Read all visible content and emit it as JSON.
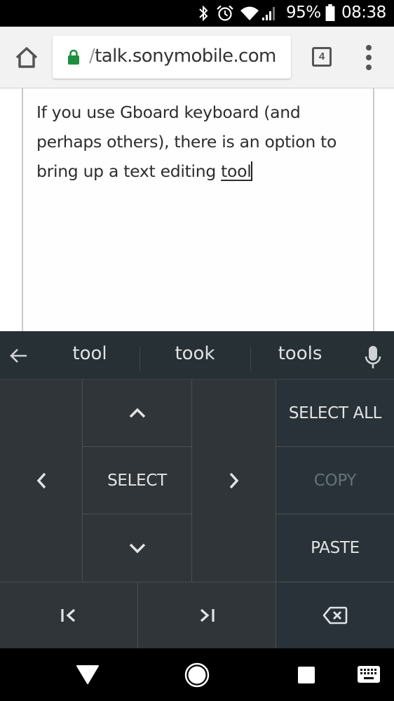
{
  "status_bar": {
    "icons": [
      "bluetooth-icon",
      "alarm-icon",
      "wifi-icon",
      "cell-signal-icon",
      "battery-icon"
    ],
    "battery": "95%",
    "time": "08:38"
  },
  "browser": {
    "url_prefix": "/",
    "url": "talk.sonymobile.com",
    "secure": true,
    "tab_count": "4",
    "colors": {
      "lock": "#1e8e3e"
    }
  },
  "editor": {
    "text_before": "If you use Gboard keyboard (and perhaps others), there is an option to bring up a text editing ",
    "composing_word": "tool"
  },
  "keyboard": {
    "suggestions": [
      "tool",
      "took",
      "tools"
    ],
    "editing_panel": {
      "select_label": "SELECT",
      "select_all_label": "SELECT ALL",
      "copy_label": "COPY",
      "paste_label": "PASTE",
      "copy_enabled": false
    },
    "colors": {
      "background": "#2f3539",
      "action_background": "#283238",
      "text": "#e2e4e5",
      "disabled_text": "#65727a"
    }
  },
  "nav_bar": {
    "buttons": [
      "back",
      "home",
      "recents",
      "keyboard-switch"
    ]
  }
}
